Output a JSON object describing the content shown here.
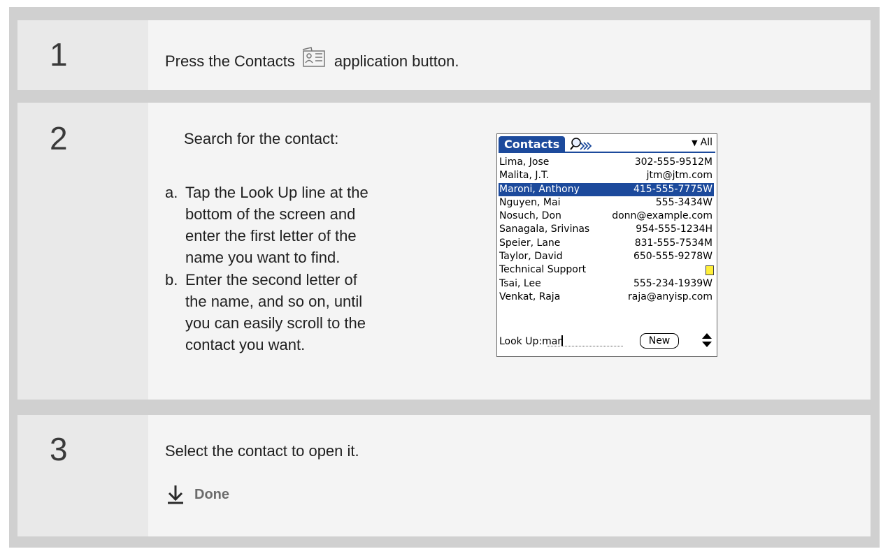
{
  "steps": [
    {
      "number": "1",
      "text_before": "Press the Contacts",
      "text_after": "application button.",
      "icon": "contacts-card-icon"
    },
    {
      "number": "2",
      "intro": "Search for the contact:",
      "substeps": [
        {
          "letter": "a.",
          "text": "Tap the Look Up line at the bottom of the screen and enter the first letter of the name you want to find."
        },
        {
          "letter": "b.",
          "text": "Enter the second letter of the name, and so on, until you can easily scroll to the contact you want."
        }
      ]
    },
    {
      "number": "3",
      "text": "Select the contact to open it.",
      "done_label": "Done",
      "done_icon": "down-arrow-icon"
    }
  ],
  "palm": {
    "title": "Contacts",
    "category": "All",
    "lookup_label": "Look Up:",
    "lookup_value": "mar",
    "new_button": "New",
    "contacts": [
      {
        "name": "Lima, Jose",
        "detail": "302-555-9512M"
      },
      {
        "name": "Malita, J.T.",
        "detail": "jtm@jtm.com"
      },
      {
        "name": "Maroni, Anthony",
        "detail": "415-555-7775W",
        "selected": true
      },
      {
        "name": "Nguyen, Mai",
        "detail": "555-3434W"
      },
      {
        "name": "Nosuch, Don",
        "detail": "donn@example.com"
      },
      {
        "name": "Sanagala, Srivinas",
        "detail": "954-555-1234H"
      },
      {
        "name": "Speier, Lane",
        "detail": "831-555-7534M"
      },
      {
        "name": "Taylor, David",
        "detail": "650-555-9278W"
      },
      {
        "name": "Technical Support",
        "detail": "",
        "note": true
      },
      {
        "name": "Tsai, Lee",
        "detail": "555-234-1939W"
      },
      {
        "name": "Venkat, Raja",
        "detail": "raja@anyisp.com"
      }
    ],
    "colors": {
      "highlight": "#1c4a9c",
      "note": "#ffef3a"
    }
  }
}
